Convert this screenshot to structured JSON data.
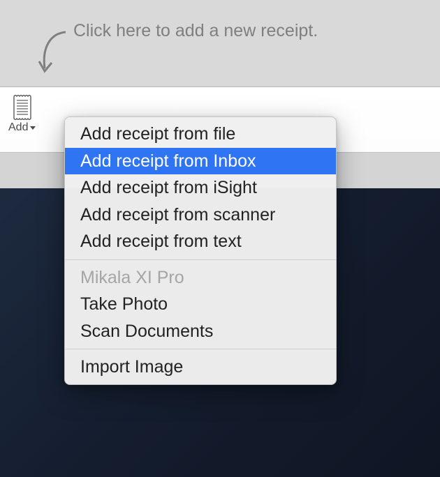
{
  "hint": {
    "text": "Click here to add a new receipt."
  },
  "toolbar": {
    "add_label": "Add"
  },
  "menu": {
    "sections": [
      {
        "items": [
          {
            "label": "Add receipt from file",
            "kind": "normal"
          },
          {
            "label": "Add receipt from Inbox",
            "kind": "highlighted"
          },
          {
            "label": "Add receipt from iSight",
            "kind": "normal"
          },
          {
            "label": "Add receipt from scanner",
            "kind": "normal"
          },
          {
            "label": "Add receipt from text",
            "kind": "normal"
          }
        ]
      },
      {
        "items": [
          {
            "label": "Mikala XI Pro",
            "kind": "disabled"
          },
          {
            "label": "Take Photo",
            "kind": "normal"
          },
          {
            "label": "Scan Documents",
            "kind": "normal"
          }
        ]
      },
      {
        "items": [
          {
            "label": "Import Image",
            "kind": "normal"
          }
        ]
      }
    ]
  }
}
